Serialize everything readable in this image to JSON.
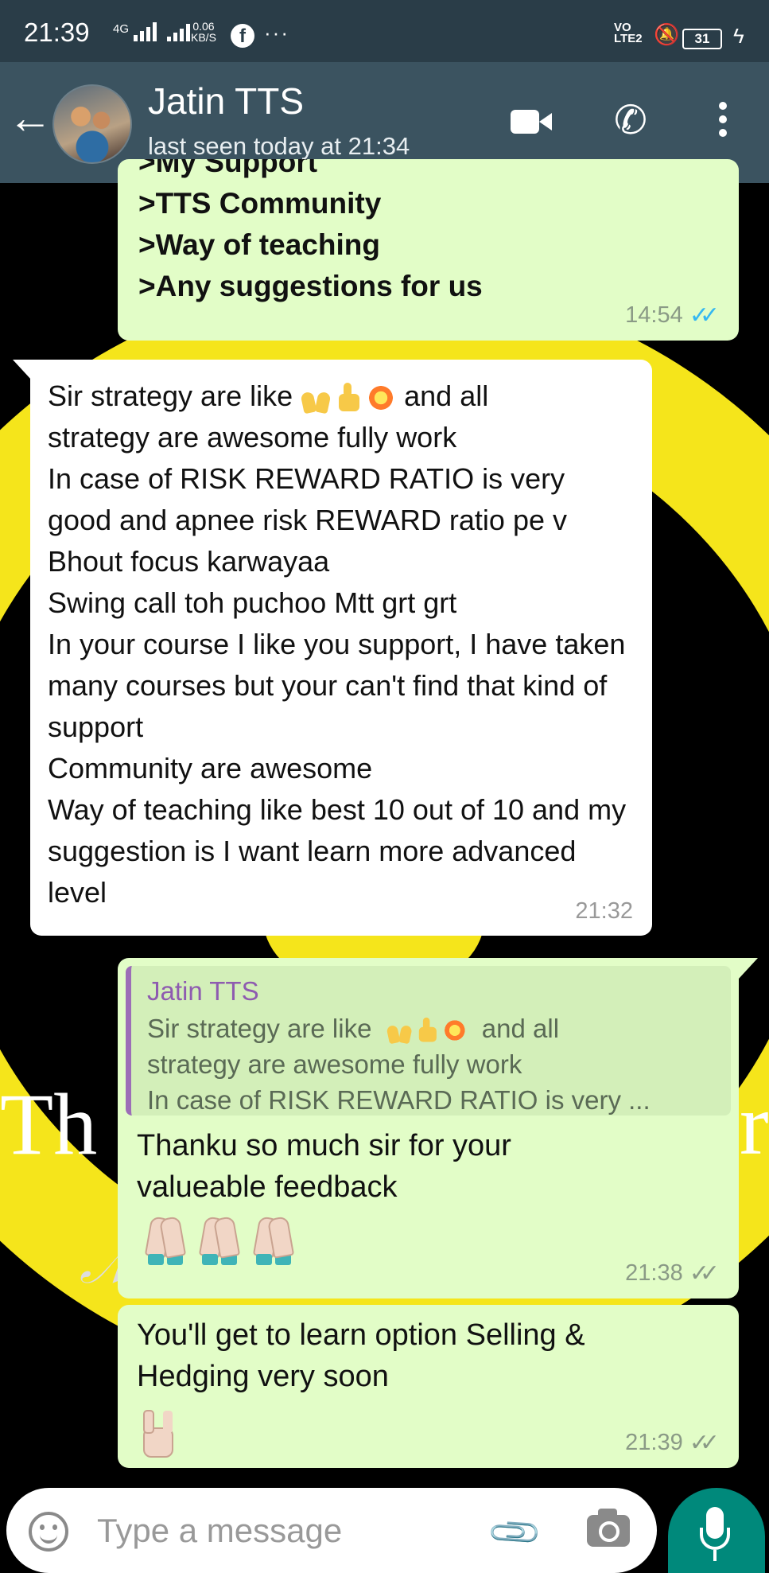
{
  "status_bar": {
    "time": "21:39",
    "network": "4G",
    "speed_value": "0.06",
    "speed_unit": "KB/S",
    "volte_top": "VO",
    "volte_bottom": "LTE2",
    "battery": "31"
  },
  "header": {
    "contact_name": "Jatin TTS",
    "last_seen": "last seen today at 21:34"
  },
  "wallpaper": {
    "text_left": "Th",
    "text_right": "r"
  },
  "messages": [
    {
      "direction": "outgoing",
      "lines": [
        ">My Support",
        ">TTS Community",
        ">Way of teaching",
        ">Any suggestions for us"
      ],
      "time": "14:54",
      "ticks": "read"
    },
    {
      "direction": "incoming",
      "text_start": "Sir strategy are like",
      "text_after_emoji": " and all",
      "text": "strategy  are awesome fully work\nIn case of RISK REWARD RATIO  is very good  and apnee risk REWARD ratio pe v Bhout focus karwayaa\nSwing call toh puchoo Mtt grt grt\nIn your course I like you support,  I have taken many courses but your can't find that kind of support\nCommunity are awesome\nWay of teaching like best 10 out of 10 and my suggestion is I want learn more advanced level",
      "emoji": [
        "raising-hands",
        "thumbs-up",
        "collision"
      ],
      "time": "21:32"
    },
    {
      "direction": "outgoing",
      "quote_author": "Jatin TTS",
      "quote_start": "Sir strategy are like",
      "quote_after_emoji": " and all",
      "quote_text": "strategy  are awesome fully work\nIn case of RISK REWARD RATIO  is very ...",
      "text": "Thanku so much sir for your valueable feedback",
      "emoji": [
        "folded-hands",
        "folded-hands",
        "folded-hands"
      ],
      "time": "21:38",
      "ticks": "delivered"
    },
    {
      "direction": "outgoing",
      "text": "You'll get to learn option Selling & Hedging very soon",
      "emoji": [
        "love-you-gesture"
      ],
      "time": "21:39",
      "ticks": "delivered"
    }
  ],
  "composer": {
    "placeholder": "Type a message"
  },
  "colors": {
    "header": "#3b5360",
    "status_bar": "#2a3d48",
    "outgoing_bubble": "#e2fdc7",
    "incoming_bubble": "#ffffff",
    "read_ticks": "#34b7f1",
    "mic_button": "#00897b",
    "wallpaper_accent": "#f5e51b"
  }
}
